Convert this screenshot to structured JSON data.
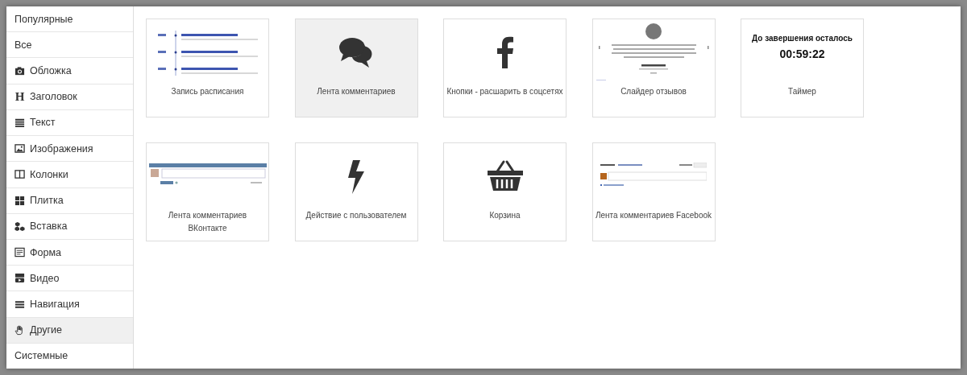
{
  "sidebar": {
    "items": [
      {
        "label": "Популярные",
        "kind": "plain",
        "selected": false
      },
      {
        "label": "Все",
        "kind": "plain",
        "selected": false
      },
      {
        "label": "Обложка",
        "kind": "camera",
        "selected": false
      },
      {
        "label": "Заголовок",
        "kind": "glyph",
        "glyph": "H",
        "selected": false
      },
      {
        "label": "Текст",
        "kind": "lines",
        "selected": false
      },
      {
        "label": "Изображения",
        "kind": "image",
        "selected": false
      },
      {
        "label": "Колонки",
        "kind": "columns",
        "selected": false
      },
      {
        "label": "Плитка",
        "kind": "tiles",
        "selected": false
      },
      {
        "label": "Вставка",
        "kind": "cubes",
        "selected": false
      },
      {
        "label": "Форма",
        "kind": "form",
        "selected": false
      },
      {
        "label": "Видео",
        "kind": "video",
        "selected": false
      },
      {
        "label": "Навигация",
        "kind": "menu",
        "selected": false
      },
      {
        "label": "Другие",
        "kind": "hand",
        "selected": true
      },
      {
        "label": "Системные",
        "kind": "plain",
        "selected": false
      }
    ]
  },
  "blocks": [
    {
      "label": "Запись расписания",
      "kind": "schedule",
      "selected": false
    },
    {
      "label": "Лента комментариев",
      "kind": "comments-icon",
      "selected": true
    },
    {
      "label": "Кнопки - расшарить в соцсетях",
      "kind": "facebook-icon",
      "selected": false
    },
    {
      "label": "Слайдер отзывов",
      "kind": "testimonials",
      "selected": false
    },
    {
      "label": "Таймер",
      "kind": "timer",
      "timer_title": "До завершения осталось",
      "timer_value": "00:59:22",
      "selected": false
    },
    {
      "label": "Лента комментариев ВКонтакте",
      "kind": "vk",
      "selected": false
    },
    {
      "label": "Действие с пользователем",
      "kind": "bolt-icon",
      "selected": false
    },
    {
      "label": "Корзина",
      "kind": "basket-icon",
      "selected": false
    },
    {
      "label": "Лента комментариев Facebook",
      "kind": "fb-comments",
      "selected": false
    }
  ]
}
